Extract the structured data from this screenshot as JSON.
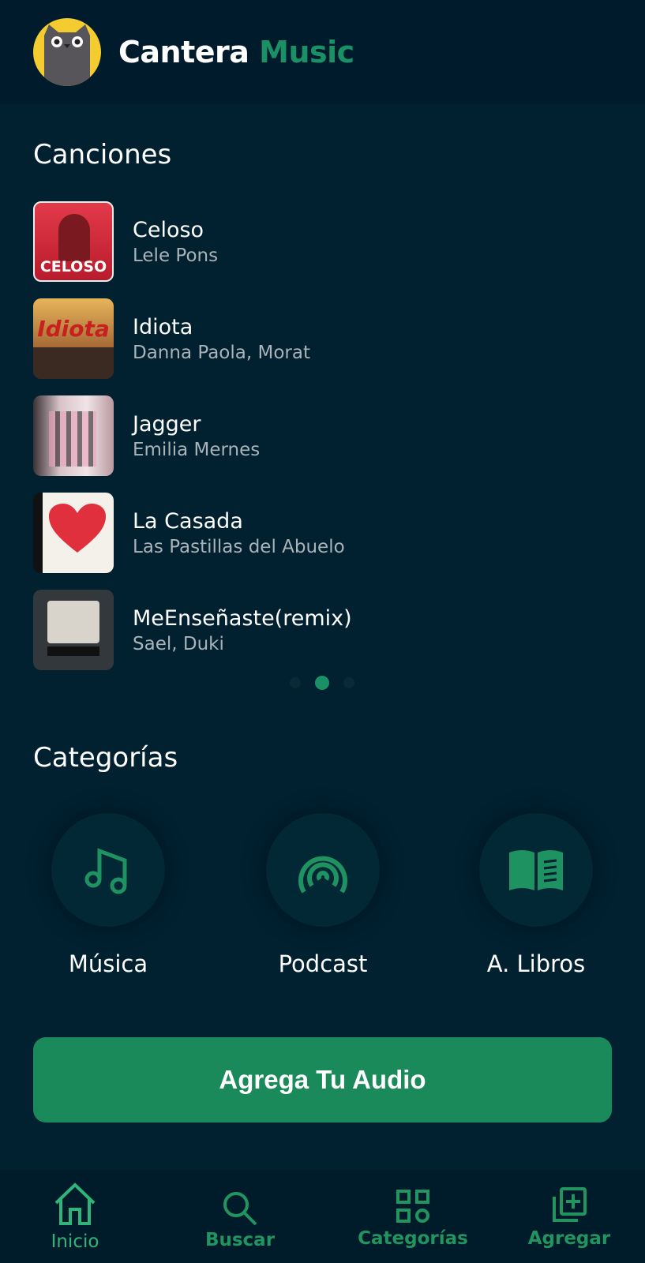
{
  "header": {
    "brand_primary": "Cantera",
    "brand_accent": "Music",
    "logo": "cat-logo"
  },
  "songs": {
    "heading": "Canciones",
    "items": [
      {
        "title": "Celoso",
        "artist": "Lele Pons",
        "cover_text": "CELOSO"
      },
      {
        "title": "Idiota",
        "artist": "Danna Paola, Morat",
        "cover_text": "Idiota"
      },
      {
        "title": "Jagger",
        "artist": "Emilia Mernes"
      },
      {
        "title": "La Casada",
        "artist": "Las Pastillas del Abuelo"
      },
      {
        "title": "MeEnseñaste(remix)",
        "artist": "Sael, Duki"
      }
    ],
    "pager": {
      "pages": 3,
      "current": 2
    }
  },
  "categories": {
    "heading": "Categorías",
    "items": [
      {
        "label": "Música",
        "icon": "music-note-icon"
      },
      {
        "label": "Podcast",
        "icon": "podcast-icon"
      },
      {
        "label": "A. Libros",
        "icon": "book-icon"
      }
    ]
  },
  "cta": {
    "label": "Agrega Tu Audio"
  },
  "nav": {
    "items": [
      {
        "label": "Inicio",
        "icon": "home-icon",
        "active": true
      },
      {
        "label": "Buscar",
        "icon": "search-icon"
      },
      {
        "label": "Categorías",
        "icon": "grid-icon"
      },
      {
        "label": "Agregar",
        "icon": "add-library-icon"
      }
    ]
  },
  "colors": {
    "accent": "#1a9164",
    "background": "#012030",
    "header": "#001b2b",
    "button": "#1a8a5a"
  }
}
